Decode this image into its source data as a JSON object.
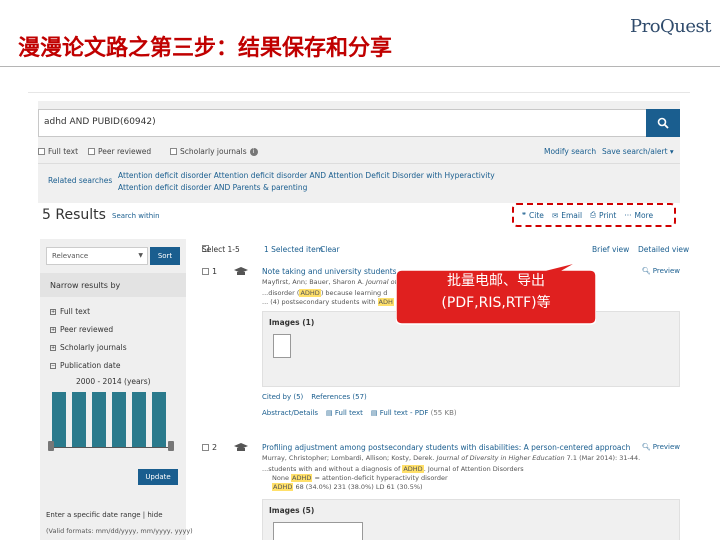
{
  "slide": {
    "title": "漫漫论文路之第三步：结果保存和分享",
    "logo_text": "ProQuest"
  },
  "search": {
    "query": "adhd AND PUBID(60942)",
    "filters": [
      "Full text",
      "Peer reviewed",
      "Scholarly journals"
    ],
    "modify_search": "Modify search",
    "save_search": "Save search/alert ▾",
    "related_label": "Related searches",
    "related_line1": "Attention deficit disorder   Attention deficit disorder AND Attention Deficit Disorder with Hyperactivity",
    "related_line2": "Attention deficit disorder AND Parents & parenting"
  },
  "results_header": {
    "count": "5 Results",
    "search_within": "Search within",
    "actions": [
      "Cite",
      "Email",
      "Print",
      "More"
    ]
  },
  "sidebar": {
    "sort_value": "Relevance",
    "sort_button": "Sort",
    "narrow_label": "Narrow results by",
    "facets": [
      "Full text",
      "Peer reviewed",
      "Scholarly journals",
      "Publication date"
    ],
    "date_range": "2000 - 2014 (years)",
    "update_button": "Update",
    "range_link": "Enter a specific date range | hide",
    "format_hint": "(Valid formats: mm/dd/yyyy, mm/yyyy, yyyy)"
  },
  "toolbar": {
    "select": "Select 1-5",
    "selected": "1 Selected item",
    "clear": "Clear",
    "brief": "Brief view",
    "detailed": "Detailed view"
  },
  "results": [
    {
      "num": "1",
      "title": "Note taking and university students with",
      "authors": "Mayfirst, Ann; Bauer, Sharon A",
      "journal": "Journal of",
      "snippet_pre": "...disorder (",
      "snippet_hl": "ADHD",
      "snippet_post": ") because learning d",
      "snippet2": "... (4) postsecondary students with",
      "snippet2_hl": "ADH",
      "images_label": "Images (1)",
      "cited": "Cited by (5)",
      "references": "References (57)",
      "abstract": "Abstract/Details",
      "fulltext": "Full text",
      "pdf": "Full text - PDF",
      "pdf_size": "(55 KB)",
      "preview": "Preview"
    },
    {
      "num": "2",
      "title": "Profiling adjustment among postsecondary students with disabilities: A person-centered approach",
      "authors": "Murray, Christopher; Lombardi, Allison; Kosty, Derek.",
      "journal": "Journal of Diversity in Higher Education",
      "citation": "7.1 (Mar 2014): 31-44.",
      "snippet_pre": "...students with and without a diagnosis of",
      "snippet_hl": "ADHD",
      "snippet_post": ". Journal of Attention Disorders",
      "snippet2": "None",
      "snippet2_hl": "ADHD",
      "snippet2_post": "= attention-deficit hyperactivity disorder",
      "snippet3_hl": "ADHD",
      "snippet3_post": "68 (34.0%) 231 (38.0%) LD 61 (30.5%)",
      "images_label": "Images (5)",
      "preview": "Preview"
    }
  ],
  "callout": {
    "line1": "批量电邮、导出",
    "line2": "(PDF,RIS,RTF)等",
    "fill": "#e0201f"
  },
  "histogram_values": [
    0.95,
    0.95,
    0.95,
    0.95,
    0.95,
    0.95
  ]
}
